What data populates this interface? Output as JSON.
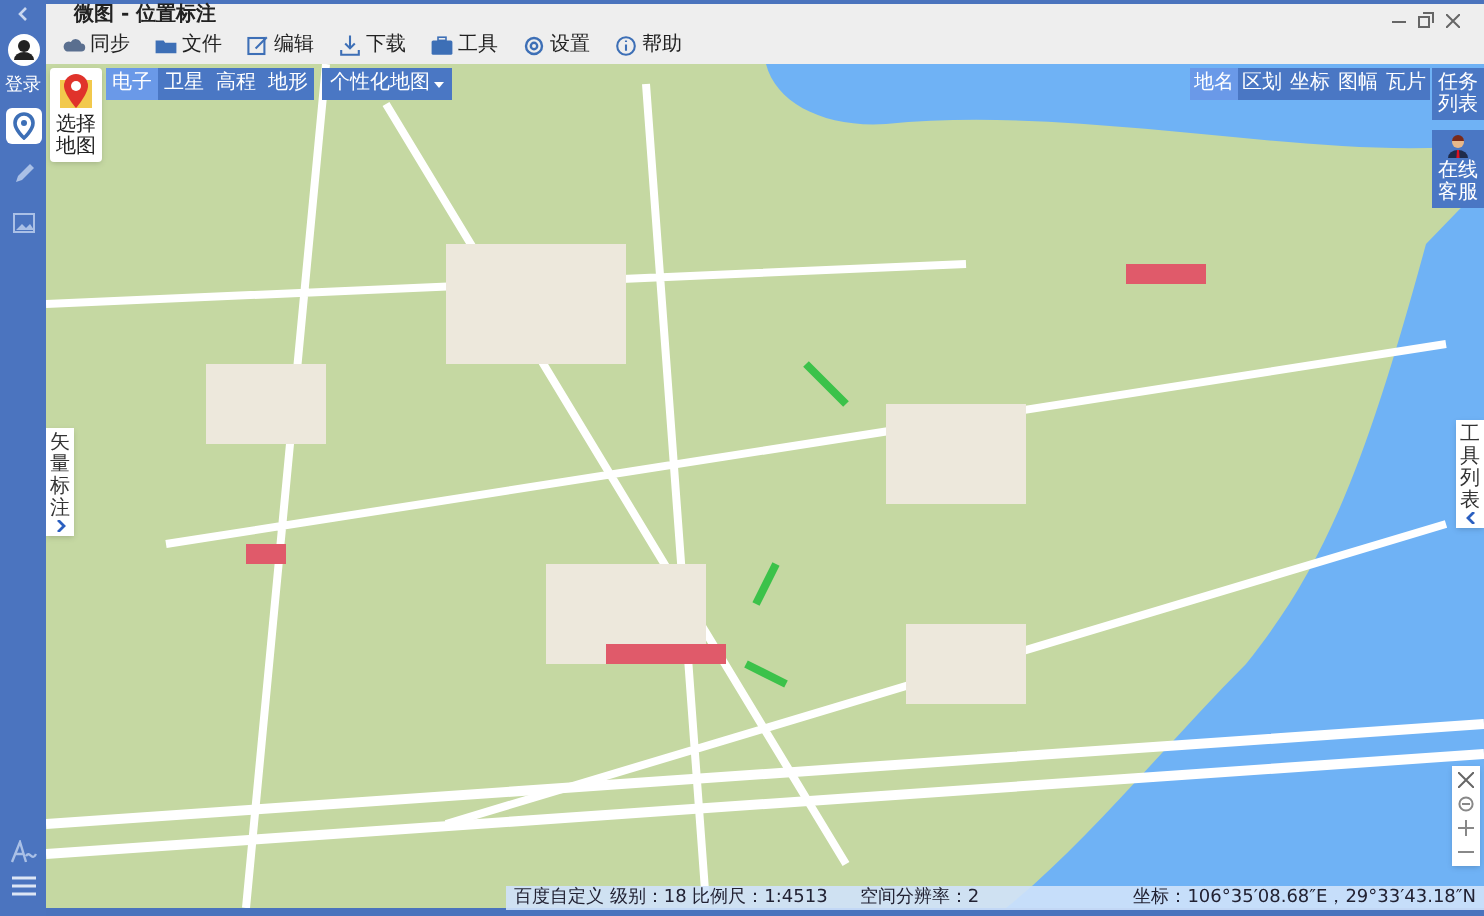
{
  "window": {
    "title": "微图 - 位置标注"
  },
  "toolbar": [
    {
      "label": "同步"
    },
    {
      "label": "文件"
    },
    {
      "label": "编辑"
    },
    {
      "label": "下载"
    },
    {
      "label": "工具"
    },
    {
      "label": "设置"
    },
    {
      "label": "帮助"
    }
  ],
  "sidebar": {
    "login": "登录",
    "tools": [
      {
        "selected": true
      },
      {
        "selected": false
      },
      {
        "selected": false
      }
    ]
  },
  "map_picker": {
    "label": "选择地图"
  },
  "map_types": [
    {
      "label": "电子",
      "selected": true
    },
    {
      "label": "卫星",
      "selected": false
    },
    {
      "label": "高程",
      "selected": false
    },
    {
      "label": "地形",
      "selected": false
    }
  ],
  "custom_map": {
    "label": "个性化地图"
  },
  "search_tabs": [
    {
      "label": "地名",
      "selected": true
    },
    {
      "label": "区划",
      "selected": false
    },
    {
      "label": "坐标",
      "selected": false
    },
    {
      "label": "图幅",
      "selected": false
    },
    {
      "label": "瓦片",
      "selected": false
    }
  ],
  "task_list": {
    "label": "任务列表"
  },
  "online_service": {
    "label": "在线客服"
  },
  "left_panel_tab": {
    "label": "矢量标注"
  },
  "right_panel_tab": {
    "label": "工具列表"
  },
  "status_bar": {
    "level": "百度自定义 级别：18 比例尺：1:4513",
    "resolution": "空间分辨率：2",
    "coordinates": "坐标：106°35′08.68″E，29°33′43.18″N"
  }
}
